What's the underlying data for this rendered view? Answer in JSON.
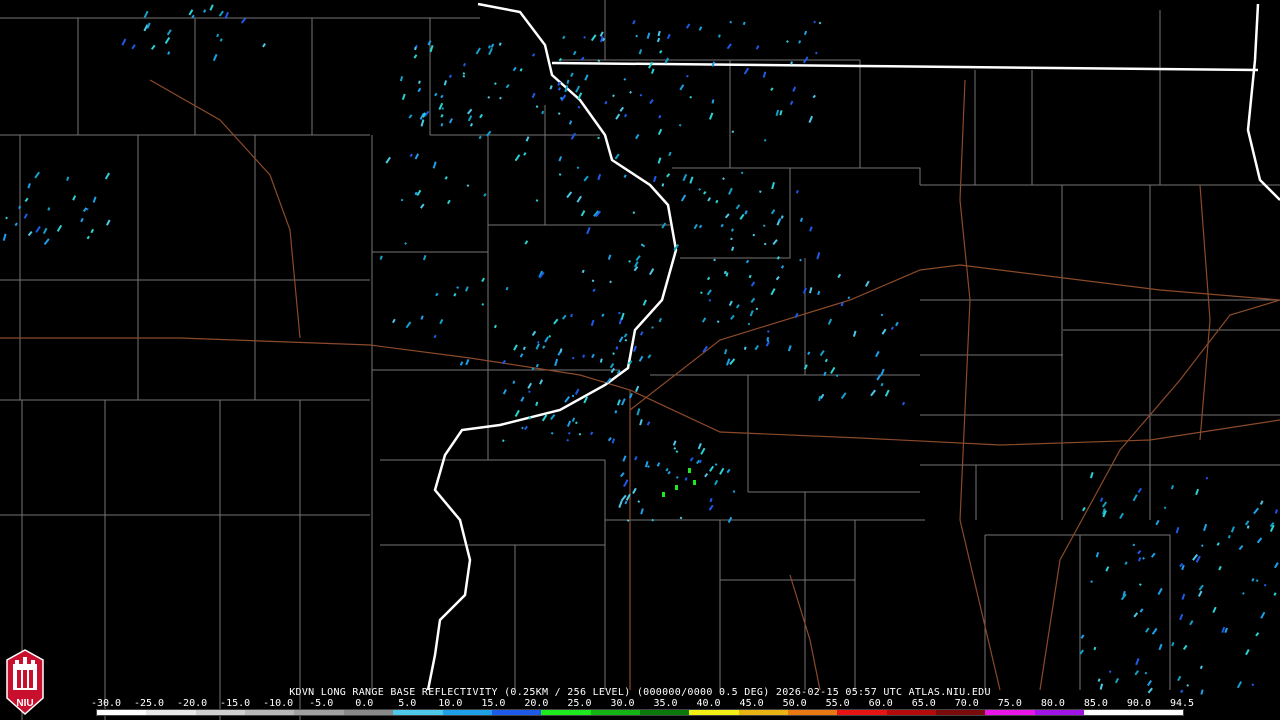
{
  "title": "KDVN LONG RANGE BASE REFLECTIVITY (0.25KM / 256 LEVEL) (000000/0000 0.5 DEG) 2026-02-15 05:57 UTC  ATLAS.NIU.EDU",
  "logo_text": "NIU",
  "colors": {
    "background": "#000000",
    "county_lines": "#8a8a8a",
    "state_lines": "#ffffff",
    "highways": "#8b4a2a",
    "logo_red": "#c8102e"
  },
  "scale": {
    "labels": [
      "-30.0",
      "-25.0",
      "-20.0",
      "-15.0",
      "-10.0",
      "-5.0",
      "0.0",
      "5.0",
      "10.0",
      "15.0",
      "20.0",
      "25.0",
      "30.0",
      "35.0",
      "40.0",
      "45.0",
      "50.0",
      "55.0",
      "60.0",
      "65.0",
      "70.0",
      "75.0",
      "80.0",
      "85.0",
      "90.0",
      "94.5"
    ],
    "colors": [
      "#ffffff",
      "#e8e8e8",
      "#d0d0d0",
      "#b8b8b8",
      "#a0a0a0",
      "#888888",
      "#4ec8e8",
      "#1ea0e8",
      "#1e5ae8",
      "#1ee81e",
      "#14b414",
      "#0a780a",
      "#f0f014",
      "#e8b414",
      "#e87814",
      "#e81414",
      "#b40a0a",
      "#780a0a",
      "#e814e8",
      "#a014e8",
      "#ffffff",
      "#ffffff"
    ]
  }
}
